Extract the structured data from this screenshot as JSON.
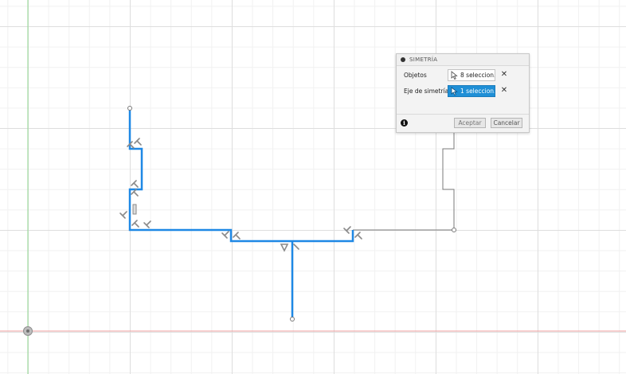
{
  "dialog": {
    "title": "SIMETRÍA",
    "objects_label": "Objetos",
    "objects_value": "8 seleccion...",
    "axis_label": "Eje de simetría",
    "axis_value": "1 seleccion...",
    "ok_label": "Aceptar",
    "cancel_label": "Cancelar",
    "info_glyph": "i",
    "clear_glyph": "✕"
  },
  "colors": {
    "selected_line": "#1e88e5",
    "unselected_line": "#7a7a7a",
    "x_axis": "#f0a0a0",
    "y_axis": "#90d890",
    "grid_major": "#dedede",
    "grid_minor": "#f1f1f1",
    "constraint_icon": "#8a8a8a",
    "active_selection": "#1f8fd6"
  },
  "icons": {
    "origin": "origin-icon",
    "perpendicular": "perpendicular-constraint-icon",
    "parallel": "parallel-constraint-icon",
    "symmetry": "symmetry-constraint-icon",
    "cursor": "cursor-arrow-icon",
    "info": "info-icon"
  }
}
